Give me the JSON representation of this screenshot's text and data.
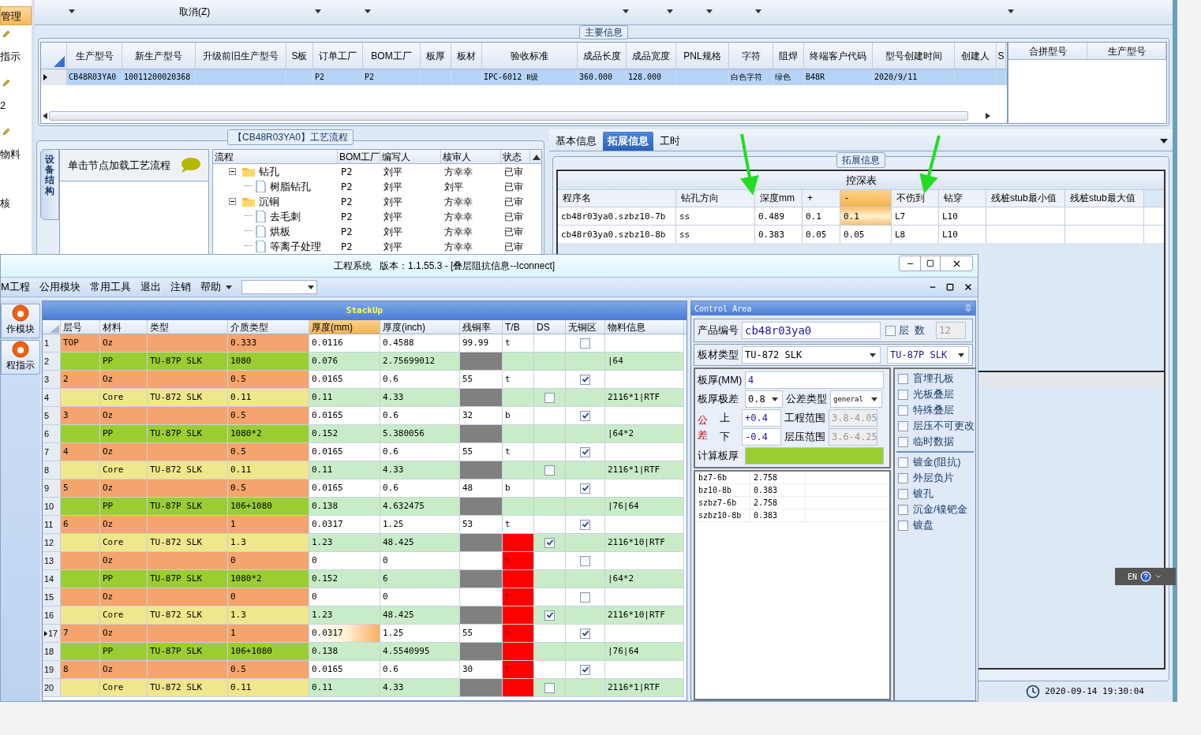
{
  "sidebar": {
    "items": [
      {
        "label": "管理",
        "selected": true
      },
      {
        "label": "指示",
        "selected": false
      },
      {
        "label": "2",
        "selected": false
      },
      {
        "label": "物料",
        "selected": false
      },
      {
        "label": "核",
        "selected": false
      }
    ]
  },
  "toolbar": {
    "cancel": "取消(Z)"
  },
  "main_info": {
    "title": "主要信息",
    "columns": [
      "生产型号",
      "新生产型号",
      "升级前旧生产型号",
      "S板",
      "订单工厂",
      "BOM工厂",
      "板厚",
      "板材",
      "验收标准",
      "成品长度",
      "成品宽度",
      "PNL规格",
      "字符",
      "阻焊",
      "终端客户代码",
      "型号创建时间",
      "创建人",
      "S"
    ],
    "rows": [
      {
        "selected": true,
        "cells": [
          "CB48R03YA0",
          "10011200020368",
          "",
          "",
          "P2",
          "P2",
          "",
          "",
          "IPC-6012 Ⅱ级",
          "360.000",
          "128.000",
          "",
          "白色字符",
          "绿色",
          "B48R",
          "2020/9/11",
          "",
          ""
        ]
      }
    ],
    "merge_columns": [
      "合拼型号",
      "生产型号"
    ]
  },
  "process_flow": {
    "title": "【CB48R03YA0】工艺流程",
    "side_tab": "设备结构",
    "hint": "单击节点加载工艺流程",
    "columns": [
      "流程",
      "BOM工厂",
      "编写人",
      "核审人",
      "状态"
    ],
    "tree": [
      {
        "name": "钻孔",
        "expanded": true,
        "cells": [
          "P2",
          "刘平",
          "方幸幸",
          "已审"
        ],
        "children": [
          {
            "name": "树脂钻孔",
            "cells": [
              "P2",
              "刘平",
              "刘平",
              "已审"
            ]
          }
        ]
      },
      {
        "name": "沉铜",
        "expanded": true,
        "cells": [
          "P2",
          "刘平",
          "方幸幸",
          "已审"
        ],
        "children": [
          {
            "name": "去毛刺",
            "cells": [
              "P2",
              "刘平",
              "方幸幸",
              "已审"
            ]
          },
          {
            "name": "烘板",
            "cells": [
              "P2",
              "刘平",
              "方幸幸",
              "已审"
            ]
          },
          {
            "name": "等离子处理",
            "cells": [
              "P2",
              "刘平",
              "方幸幸",
              "已审"
            ]
          }
        ]
      }
    ]
  },
  "ext_panel": {
    "tabs": [
      {
        "label": "基本信息",
        "selected": false
      },
      {
        "label": "拓展信息",
        "selected": true
      },
      {
        "label": "工时",
        "selected": false
      }
    ],
    "group_title": "拓展信息",
    "table_title": "控深表",
    "columns": [
      {
        "label": "程序名",
        "selected": false
      },
      {
        "label": "钻孔方向",
        "selected": false
      },
      {
        "label": "深度mm",
        "selected": false
      },
      {
        "label": "+",
        "selected": false
      },
      {
        "label": "-",
        "selected": true
      },
      {
        "label": "不伤到",
        "selected": false
      },
      {
        "label": "钻穿",
        "selected": false
      },
      {
        "label": "残桩stub最小值",
        "selected": false
      },
      {
        "label": "残桩stub最大值",
        "selected": false
      }
    ],
    "rows": [
      {
        "selected": true,
        "cells": [
          "cb48r03ya0.szbz10-7b",
          "ss",
          "0.489",
          "0.1",
          "0.1",
          "L7",
          "L10",
          "",
          ""
        ]
      },
      {
        "selected": false,
        "cells": [
          "cb48r03ya0.szbz10-8b",
          "ss",
          "0.383",
          "0.05",
          "0.05",
          "L8",
          "L10",
          "",
          ""
        ]
      }
    ]
  },
  "status_bar": {
    "time": "2020-09-14 19:30:04"
  },
  "language_bar": {
    "label": "EN"
  },
  "window": {
    "title": "工程系统   版本：1.1.55.3 - [叠层阻抗信息--Iconnect]",
    "menu": [
      "M工程",
      "公用模块",
      "常用工具",
      "退出",
      "注销",
      "帮助"
    ],
    "nav": [
      {
        "label": "作模块",
        "selected": false
      },
      {
        "label": "程指示",
        "selected": false
      }
    ],
    "stackup": {
      "title": "StackUp",
      "columns": [
        {
          "label": "层号",
          "selected": false
        },
        {
          "label": "材料",
          "selected": false
        },
        {
          "label": "类型",
          "selected": false
        },
        {
          "label": "介质类型",
          "selected": false
        },
        {
          "label": "厚度(mm)",
          "selected": true
        },
        {
          "label": "厚度(inch)",
          "selected": false
        },
        {
          "label": "残铜率",
          "selected": false
        },
        {
          "label": "T/B",
          "selected": false
        },
        {
          "label": "DS",
          "selected": false
        },
        {
          "label": "无铜区",
          "selected": false
        },
        {
          "label": "物料信息",
          "selected": false
        }
      ],
      "rows": [
        {
          "n": "1",
          "kind": "oz",
          "selected": false,
          "layer": "TOP",
          "material": "Oz",
          "dielectric": "0.333",
          "thk_mm": "0.0116",
          "thk_inch": "0.4588",
          "copper": "99.99",
          "tb": "t",
          "tb_alert": false,
          "no_copper": false
        },
        {
          "n": "2",
          "kind": "pp",
          "selected": false,
          "material": "PP",
          "type": "TU-87P SLK",
          "dielectric": "1080",
          "thk_mm": "0.076",
          "thk_inch": "2.75699012",
          "tb_alert": false,
          "info": "|64"
        },
        {
          "n": "3",
          "kind": "oz",
          "selected": false,
          "layer": "2",
          "material": "Oz",
          "dielectric": "0.5",
          "thk_mm": "0.0165",
          "thk_inch": "0.6",
          "copper": "55",
          "tb": "t",
          "tb_alert": false,
          "no_copper": true
        },
        {
          "n": "4",
          "kind": "core",
          "selected": false,
          "material": "Core",
          "type": "TU-872 SLK",
          "dielectric": "0.11",
          "thk_mm": "0.11",
          "thk_inch": "4.33",
          "tb_alert": false,
          "ds": false,
          "info": "2116*1|RTF"
        },
        {
          "n": "5",
          "kind": "oz",
          "selected": false,
          "layer": "3",
          "material": "Oz",
          "dielectric": "0.5",
          "thk_mm": "0.0165",
          "thk_inch": "0.6",
          "copper": "32",
          "tb": "b",
          "tb_alert": false,
          "no_copper": true
        },
        {
          "n": "6",
          "kind": "pp",
          "selected": false,
          "material": "PP",
          "type": "TU-87P SLK",
          "dielectric": "1080*2",
          "thk_mm": "0.152",
          "thk_inch": "5.380056",
          "tb_alert": false,
          "info": "|64*2"
        },
        {
          "n": "7",
          "kind": "oz",
          "selected": false,
          "layer": "4",
          "material": "Oz",
          "dielectric": "0.5",
          "thk_mm": "0.0165",
          "thk_inch": "0.6",
          "copper": "55",
          "tb": "t",
          "tb_alert": false,
          "no_copper": true
        },
        {
          "n": "8",
          "kind": "core",
          "selected": false,
          "material": "Core",
          "type": "TU-872 SLK",
          "dielectric": "0.11",
          "thk_mm": "0.11",
          "thk_inch": "4.33",
          "tb_alert": false,
          "ds": false,
          "info": "2116*1|RTF"
        },
        {
          "n": "9",
          "kind": "oz",
          "selected": false,
          "layer": "5",
          "material": "Oz",
          "dielectric": "0.5",
          "thk_mm": "0.0165",
          "thk_inch": "0.6",
          "copper": "48",
          "tb": "b",
          "tb_alert": false,
          "no_copper": true
        },
        {
          "n": "10",
          "kind": "pp",
          "selected": false,
          "material": "PP",
          "type": "TU-87P SLK",
          "dielectric": "106+1080",
          "thk_mm": "0.138",
          "thk_inch": "4.632475",
          "tb_alert": false,
          "info": "|76|64"
        },
        {
          "n": "11",
          "kind": "oz",
          "selected": false,
          "layer": "6",
          "material": "Oz",
          "dielectric": "1",
          "thk_mm": "0.0317",
          "thk_inch": "1.25",
          "copper": "53",
          "tb": "t",
          "tb_alert": false,
          "no_copper": true
        },
        {
          "n": "12",
          "kind": "core",
          "selected": false,
          "material": "Core",
          "type": "TU-872 SLK",
          "dielectric": "1.3",
          "thk_mm": "1.23",
          "thk_inch": "48.425",
          "tb_alert": true,
          "ds": true,
          "info": "2116*10|RTF"
        },
        {
          "n": "13",
          "kind": "oz",
          "selected": false,
          "material": "Oz",
          "dielectric": "0",
          "thk_mm": "0",
          "thk_inch": "0",
          "tb": "b",
          "tb_alert": true,
          "no_copper": false
        },
        {
          "n": "14",
          "kind": "pp",
          "selected": false,
          "material": "PP",
          "type": "TU-87P SLK",
          "dielectric": "1080*2",
          "thk_mm": "0.152",
          "thk_inch": "6",
          "tb_alert": true,
          "info": "|64*2"
        },
        {
          "n": "15",
          "kind": "oz",
          "selected": false,
          "material": "Oz",
          "dielectric": "0",
          "thk_mm": "0",
          "thk_inch": "0",
          "tb": "t",
          "tb_alert": true,
          "no_copper": false
        },
        {
          "n": "16",
          "kind": "core",
          "selected": false,
          "material": "Core",
          "type": "TU-872 SLK",
          "dielectric": "1.3",
          "thk_mm": "1.23",
          "thk_inch": "48.425",
          "tb_alert": true,
          "ds": true,
          "info": "2116*10|RTF"
        },
        {
          "n": "17",
          "kind": "oz",
          "selected": true,
          "layer": "7",
          "material": "Oz",
          "dielectric": "1",
          "thk_mm": "0.0317",
          "thk_inch": "1.25",
          "copper": "55",
          "tb": "b",
          "tb_alert": true,
          "no_copper": true
        },
        {
          "n": "18",
          "kind": "pp",
          "selected": false,
          "material": "PP",
          "type": "TU-87P SLK",
          "dielectric": "106+1080",
          "thk_mm": "0.138",
          "thk_inch": "4.5540995",
          "tb_alert": true,
          "info": "|76|64"
        },
        {
          "n": "19",
          "kind": "oz",
          "selected": false,
          "layer": "8",
          "material": "Oz",
          "dielectric": "0.5",
          "thk_mm": "0.0165",
          "thk_inch": "0.6",
          "copper": "30",
          "tb": "t",
          "tb_alert": true,
          "no_copper": true
        },
        {
          "n": "20",
          "kind": "core",
          "selected": false,
          "material": "Core",
          "type": "TU-872 SLK",
          "dielectric": "0.11",
          "thk_mm": "0.11",
          "thk_inch": "4.33",
          "tb_alert": true,
          "ds": false,
          "info": "2116*1|RTF"
        }
      ]
    },
    "control": {
      "title": "Control Area",
      "product_label": "产品编号",
      "product": "cb48r03ya0",
      "layers_checked": false,
      "layers_label": "层  数",
      "layers": "12",
      "material_label": "板材类型",
      "core_material": "TU-872 SLK",
      "pp_material": "TU-87P SLK",
      "thickness_label": "板厚(MM)",
      "thickness": "4",
      "range_label": "板厚极差",
      "range": "0.8",
      "tol_type_label": "公差类型",
      "tol_type": "general",
      "tol_label": "公差",
      "upper_label": "上",
      "upper": "+0.4",
      "lower_label": "下",
      "lower": "-0.4",
      "eng_label": "工程范围",
      "eng": "3.8-4.05",
      "press_label": "层压范围",
      "press": "3.6-4.25",
      "calc_label": "计算板厚",
      "results": [
        {
          "name": "bz7-6b",
          "value": "2.758"
        },
        {
          "name": "bz10-8b",
          "value": "0.383"
        },
        {
          "name": "szbz7-6b",
          "value": "2.758"
        },
        {
          "name": "szbz10-8b",
          "value": "0.383"
        }
      ],
      "options": [
        {
          "label": "盲埋孔板",
          "checked": false
        },
        {
          "label": "光板叠层",
          "checked": false
        },
        {
          "label": "特殊叠层",
          "checked": false
        },
        {
          "label": "层压不可更改",
          "checked": false
        },
        {
          "label": "临时数据",
          "checked": false
        }
      ],
      "options2": [
        {
          "label": "镀金(阻抗)",
          "checked": false
        },
        {
          "label": "外层负片",
          "checked": false
        },
        {
          "label": "镀孔",
          "checked": false
        },
        {
          "label": "沉金/镍钯金",
          "checked": false
        },
        {
          "label": "镀盘",
          "checked": false
        }
      ]
    }
  }
}
